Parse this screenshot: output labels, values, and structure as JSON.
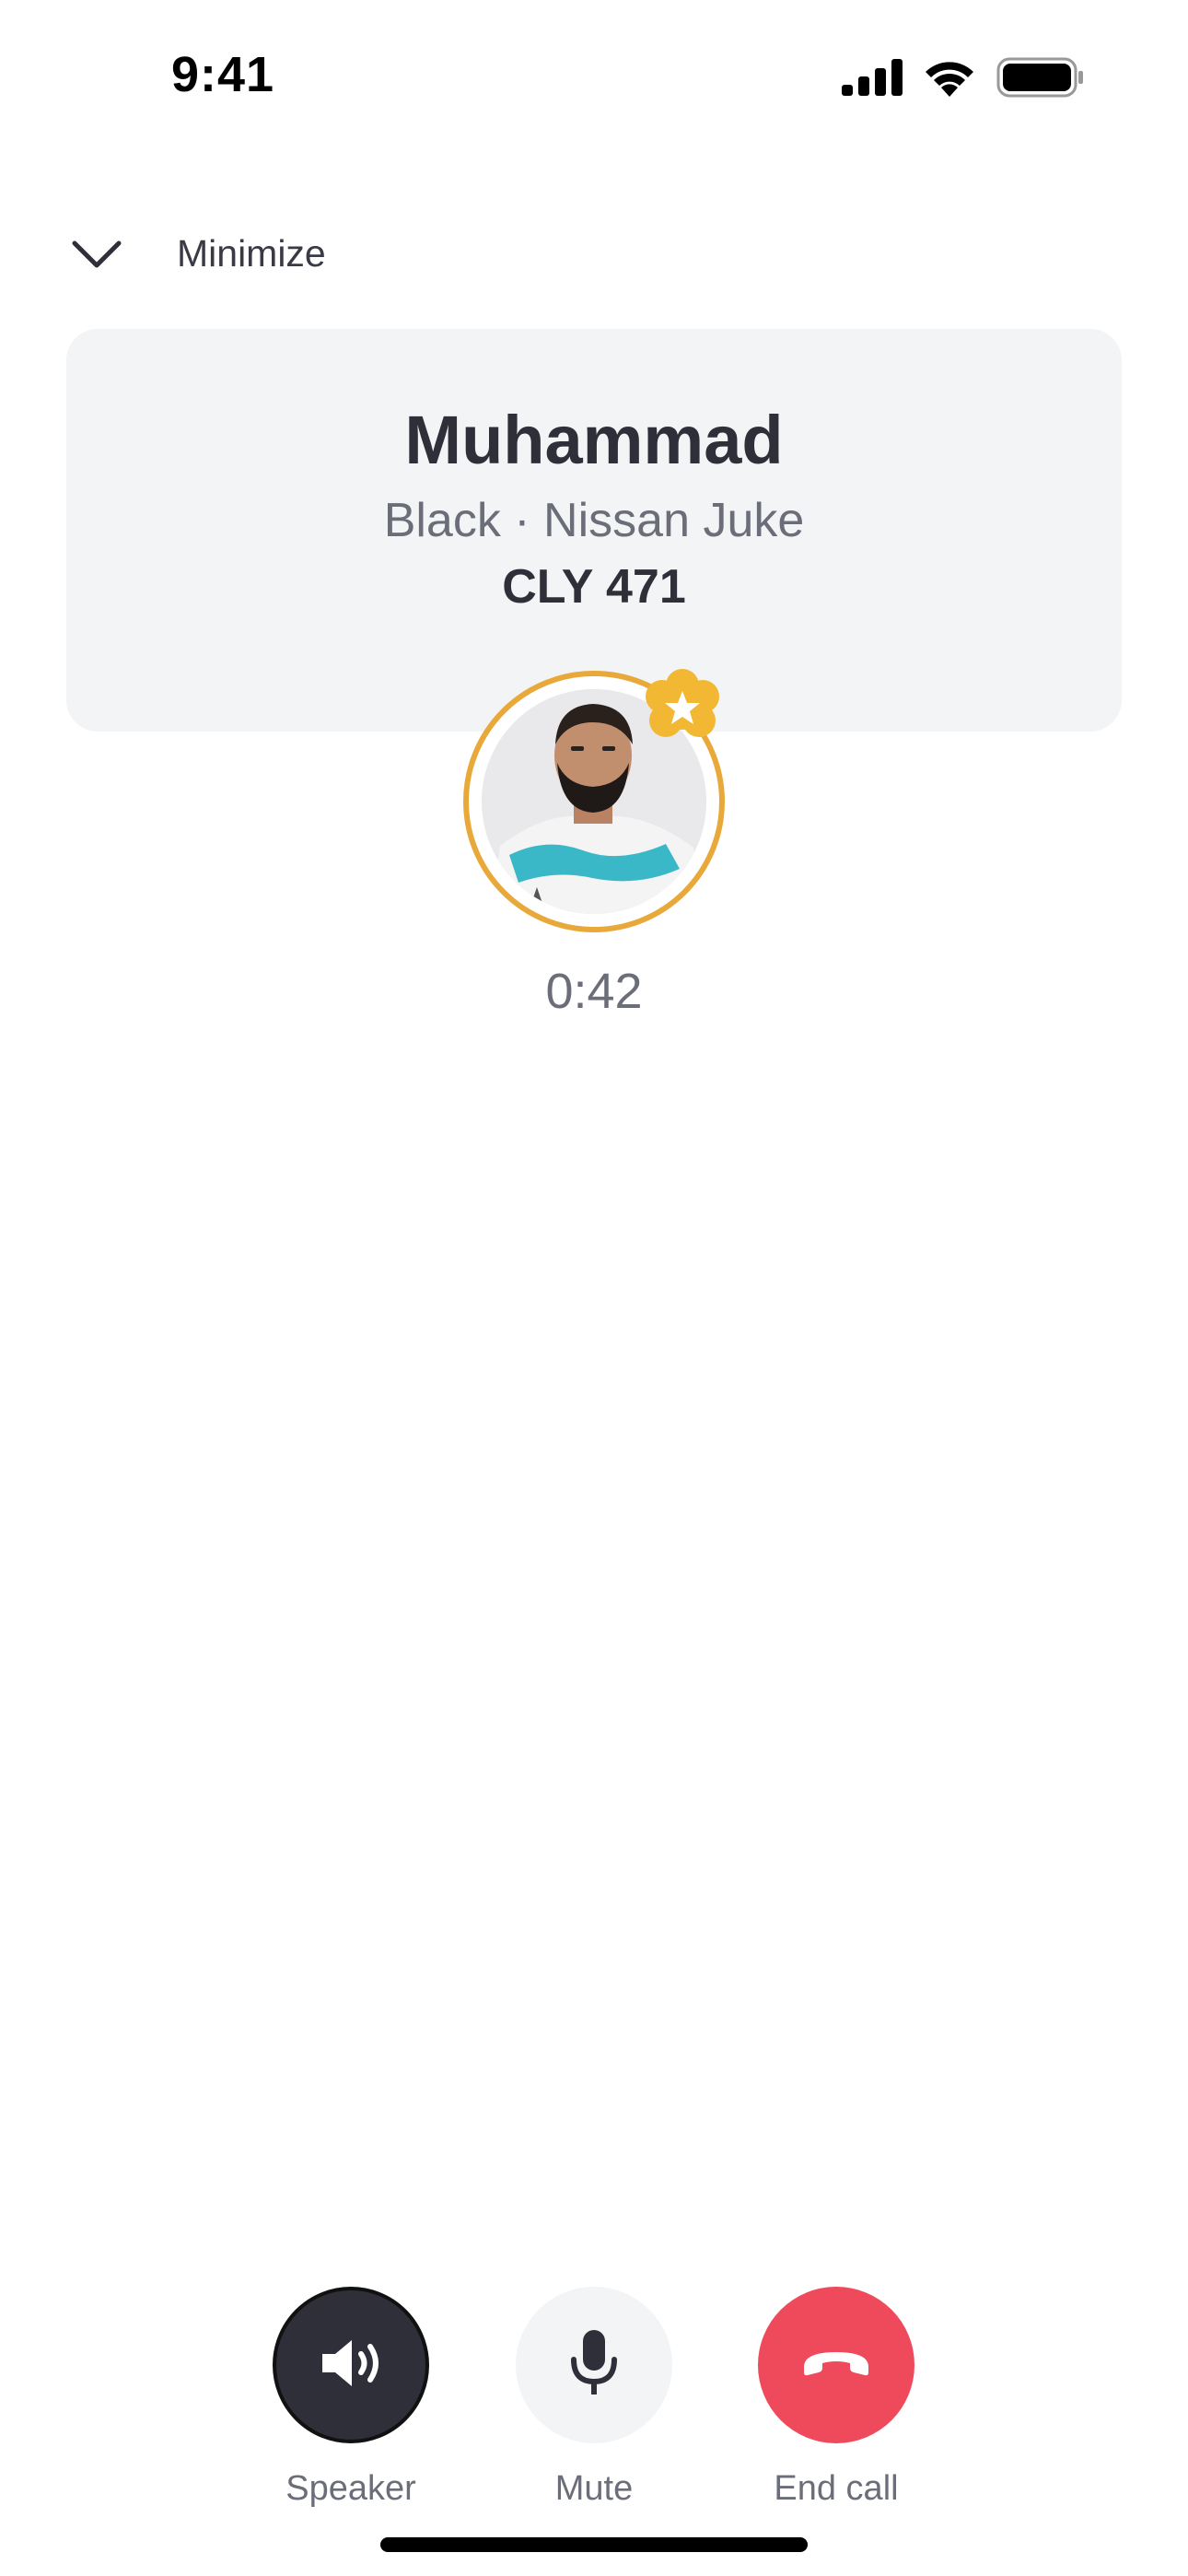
{
  "status_bar": {
    "time": "9:41",
    "signal_icon": "cellular-signal-icon",
    "wifi_icon": "wifi-icon",
    "battery_icon": "battery-icon"
  },
  "header": {
    "minimize_icon": "chevron-down-icon",
    "minimize_label": "Minimize"
  },
  "driver": {
    "name": "Muhammad",
    "vehicle": "Black · Nissan Juke",
    "plate": "CLY 471",
    "avatar_ring_color": "#e8a93a",
    "badge_icon": "star-badge-icon"
  },
  "call": {
    "duration": "0:42"
  },
  "controls": [
    {
      "label": "Speaker",
      "icon": "speaker-icon",
      "active": true
    },
    {
      "label": "Mute",
      "icon": "microphone-icon",
      "active": false
    },
    {
      "label": "End call",
      "icon": "hang-up-icon",
      "color": "#ef4a5c"
    }
  ]
}
